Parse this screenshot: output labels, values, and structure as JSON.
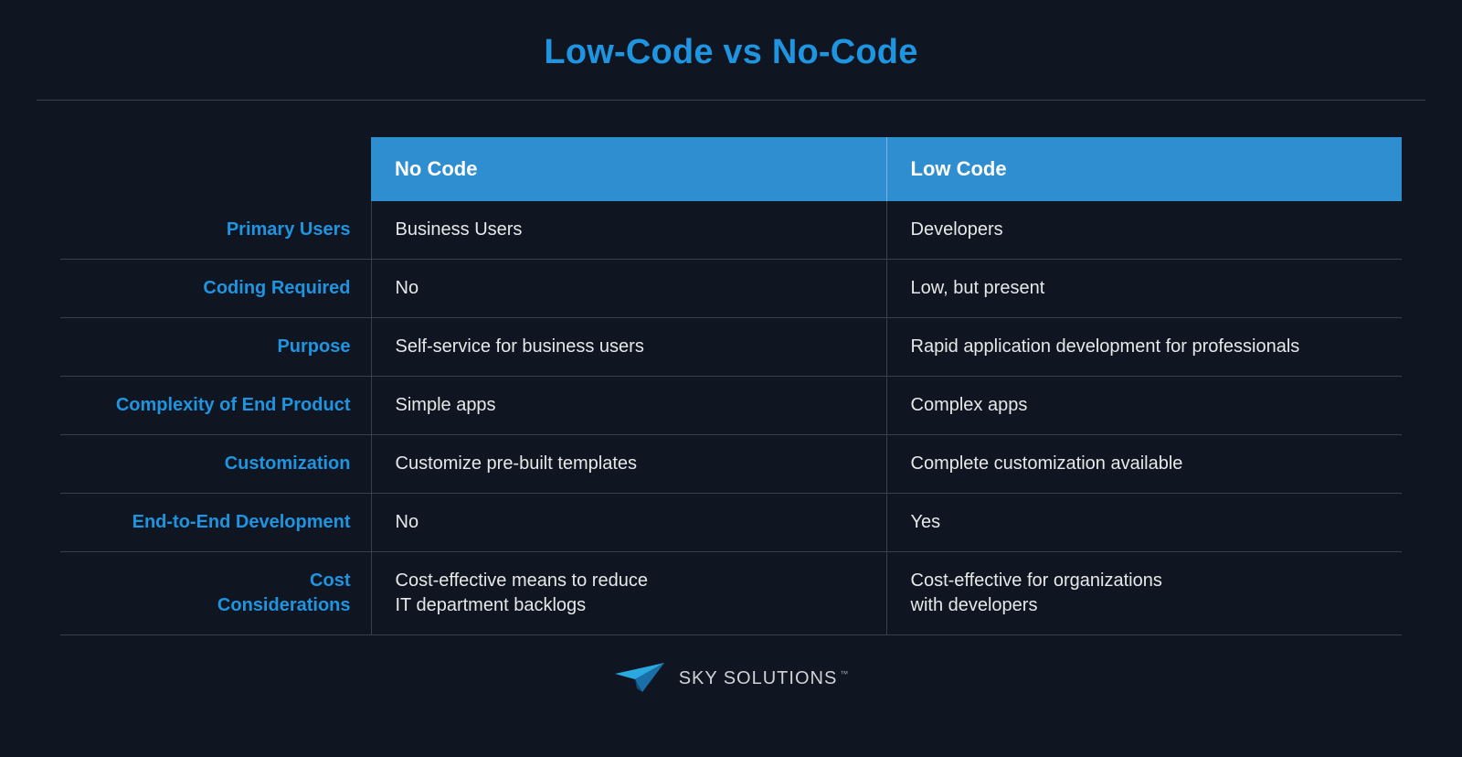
{
  "title": "Low-Code vs No-Code",
  "chart_data": {
    "type": "table",
    "title": "Low-Code vs No-Code",
    "columns": [
      "No Code",
      "Low Code"
    ],
    "rows": [
      {
        "label": "Primary Users",
        "no_code": "Business Users",
        "low_code": "Developers"
      },
      {
        "label": "Coding Required",
        "no_code": "No",
        "low_code": "Low, but present"
      },
      {
        "label": "Purpose",
        "no_code": "Self-service for business users",
        "low_code": "Rapid application development for professionals"
      },
      {
        "label": "Complexity of End Product",
        "no_code": "Simple apps",
        "low_code": "Complex apps"
      },
      {
        "label": "Customization",
        "no_code": "Customize pre-built templates",
        "low_code": "Complete customization available"
      },
      {
        "label": "End-to-End Development",
        "no_code": "No",
        "low_code": "Yes"
      },
      {
        "label": "Cost\nConsiderations",
        "no_code": "Cost-effective means to reduce\nIT department backlogs",
        "low_code": "Cost-effective for organizations\nwith developers"
      }
    ]
  },
  "footer": {
    "brand_sky": "SKY",
    "brand_solutions": "SOLUTIONS",
    "tm": "™"
  }
}
